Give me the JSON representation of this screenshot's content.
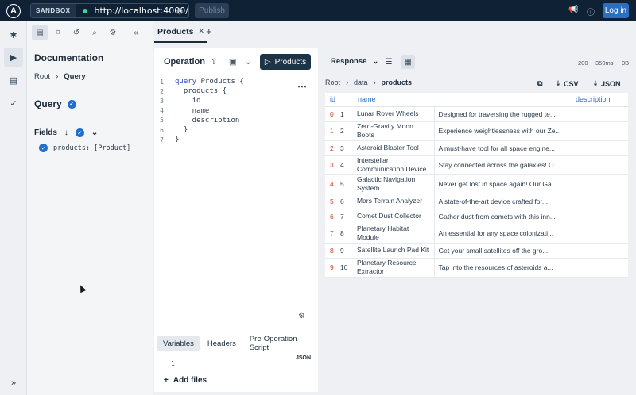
{
  "topbar": {
    "logo_letter": "A",
    "sandbox_label": "SANDBOX",
    "url": "http://localhost:4000/",
    "publish_label": "Publish",
    "login_label": "Log in"
  },
  "docs": {
    "title": "Documentation",
    "breadcrumb": [
      "Root",
      "Query"
    ],
    "query_label": "Query",
    "fields_label": "Fields",
    "field_entry": "products: [Product]"
  },
  "tab": {
    "label": "Products"
  },
  "operation": {
    "title": "Operation",
    "run_label": "Products",
    "code_lines": [
      {
        "n": "1",
        "kw": "query",
        "rest": " Products {"
      },
      {
        "n": "2",
        "kw": "",
        "rest": "  products {"
      },
      {
        "n": "3",
        "kw": "",
        "rest": "    id"
      },
      {
        "n": "4",
        "kw": "",
        "rest": "    name"
      },
      {
        "n": "5",
        "kw": "",
        "rest": "    description"
      },
      {
        "n": "6",
        "kw": "",
        "rest": "  }"
      },
      {
        "n": "7",
        "kw": "",
        "rest": "}"
      }
    ]
  },
  "variables": {
    "tabs": [
      "Variables",
      "Headers",
      "Pre-Operation Script"
    ],
    "json_tag": "JSON",
    "line_number": "1",
    "add_files": "Add files"
  },
  "response": {
    "selector": "Response",
    "status": "200",
    "time": "350ms",
    "size": "0B",
    "breadcrumb": [
      "Root",
      "data",
      "products"
    ],
    "csv_label": "CSV",
    "json_label": "JSON",
    "columns": [
      "id",
      "name",
      "description"
    ],
    "rows": [
      {
        "i": "0",
        "id": "1",
        "name": "Lunar Rover Wheels",
        "desc": "Designed for traversing the rugged te..."
      },
      {
        "i": "1",
        "id": "2",
        "name": "Zero-Gravity Moon Boots",
        "desc": "Experience weightlessness with our Ze..."
      },
      {
        "i": "2",
        "id": "3",
        "name": "Asteroid Blaster Tool",
        "desc": "A must-have tool for all space engine..."
      },
      {
        "i": "3",
        "id": "4",
        "name": "Interstellar Communication Device",
        "desc": "Stay connected across the galaxies! O..."
      },
      {
        "i": "4",
        "id": "5",
        "name": "Galactic Navigation System",
        "desc": "Never get lost in space again! Our Ga..."
      },
      {
        "i": "5",
        "id": "6",
        "name": "Mars Terrain Analyzer",
        "desc": "A state-of-the-art device crafted for..."
      },
      {
        "i": "6",
        "id": "7",
        "name": "Comet Dust Collector",
        "desc": "Gather dust from comets with this inn..."
      },
      {
        "i": "7",
        "id": "8",
        "name": "Planetary Habitat Module",
        "desc": "An essential for any space colonizati..."
      },
      {
        "i": "8",
        "id": "9",
        "name": "Satellite Launch Pad Kit",
        "desc": "Get your small satellites off the gro..."
      },
      {
        "i": "9",
        "id": "10",
        "name": "Planetary Resource Extractor",
        "desc": "Tap into the resources of asteroids a..."
      }
    ]
  },
  "colors": {
    "accent": "#2c6fbf",
    "topbar": "#0f2235",
    "index": "#d0472f"
  }
}
